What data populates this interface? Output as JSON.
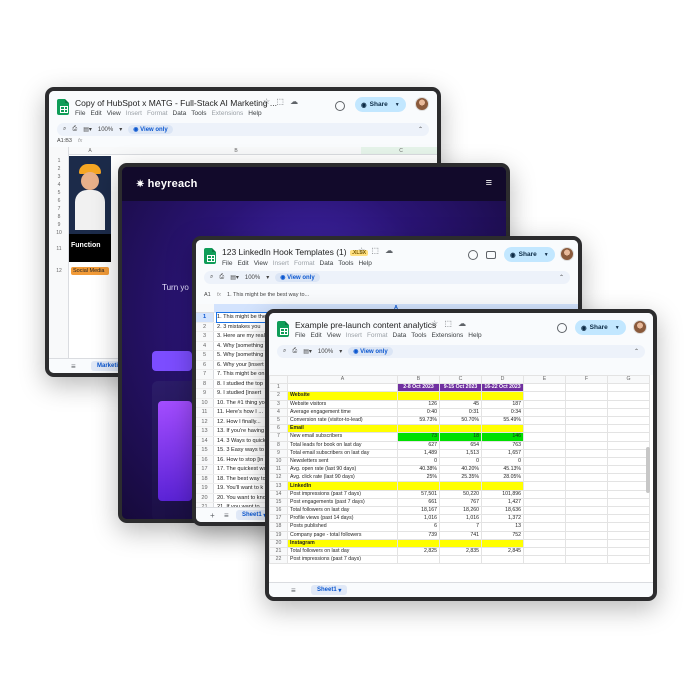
{
  "colors": {
    "accent_blue": "#0b57d0",
    "share_bg": "#c2e7ff",
    "sheets_green": "#0f9d58",
    "section_yellow": "#ffff00",
    "date_header_purple": "#7030a0",
    "highlight_green": "#00e000",
    "heyreach_bg": "#120a2b"
  },
  "win1": {
    "title": "Copy of HubSpot x MATG - Full-Stack AI Marketing ...",
    "menus": [
      "File",
      "Edit",
      "View",
      "Insert",
      "Format",
      "Data",
      "Tools",
      "Extensions",
      "Help"
    ],
    "share_label": "Share",
    "zoom": "100%",
    "view_only": "View only",
    "cell_ref": "A1:B3",
    "col_a": "A",
    "col_b": "B",
    "col_c": "C",
    "rows": [
      "1",
      "2",
      "3",
      "4",
      "5",
      "6",
      "7",
      "8",
      "9",
      "10",
      "11",
      "12"
    ],
    "function_label": "Function",
    "chip_label": "Social Media",
    "sheet_tab": "Marketin"
  },
  "win2": {
    "brand": "heyreach",
    "hero_text": "Turn yo"
  },
  "win3": {
    "title": "123 LinkedIn Hook Templates (1)",
    "badge": ".XLSX",
    "menus": [
      "File",
      "Edit",
      "View",
      "Insert",
      "Format",
      "Data",
      "Tools",
      "Help"
    ],
    "share_label": "Share",
    "zoom": "100%",
    "view_only": "View only",
    "cell_ref": "A1",
    "formula": "1. This might be the best way to...",
    "col_a": "A",
    "rows": [
      {
        "n": "1",
        "t": "1. This might be the"
      },
      {
        "n": "2",
        "t": "2. 3 mistakes you"
      },
      {
        "n": "3",
        "t": "3. Here are my real"
      },
      {
        "n": "4",
        "t": "4. Why [something"
      },
      {
        "n": "5",
        "t": "5. Why [something"
      },
      {
        "n": "6",
        "t": "6. Why your [insert"
      },
      {
        "n": "7",
        "t": "7. This might be on"
      },
      {
        "n": "8",
        "t": "8. I studied the top"
      },
      {
        "n": "9",
        "t": "9. I studied [insert"
      },
      {
        "n": "10",
        "t": "10. The #1 thing yo"
      },
      {
        "n": "11",
        "t": "11. Here's how I ..."
      },
      {
        "n": "12",
        "t": "12. How I finally..."
      },
      {
        "n": "13",
        "t": "13. If you're having"
      },
      {
        "n": "14",
        "t": "14. 3 Ways to quick"
      },
      {
        "n": "15",
        "t": "15. 3 Easy ways to"
      },
      {
        "n": "16",
        "t": "16. How to stop [in"
      },
      {
        "n": "17",
        "t": "17. The quickest wa"
      },
      {
        "n": "18",
        "t": "18. The best way to"
      },
      {
        "n": "19",
        "t": "19. You'll want to k"
      },
      {
        "n": "20",
        "t": "20. You want to kno"
      },
      {
        "n": "21",
        "t": "21. If you want to..."
      },
      {
        "n": "22",
        "t": "22. If you're ready"
      }
    ],
    "sheet_tab": "Sheet1"
  },
  "win4": {
    "title": "Example pre-launch content analytics",
    "menus": [
      "File",
      "Edit",
      "View",
      "Insert",
      "Format",
      "Data",
      "Tools",
      "Extensions",
      "Help"
    ],
    "share_label": "Share",
    "zoom": "100%",
    "view_only": "View only",
    "col_headers": [
      "A",
      "B",
      "C",
      "D",
      "E",
      "F",
      "G"
    ],
    "date_headers": [
      "2-8 Oct 2023",
      "9-15 Oct 2023",
      "16-22 Oct 2023"
    ],
    "rows": [
      {
        "n": "2",
        "label": "Website",
        "section": true
      },
      {
        "n": "3",
        "label": "Website visitors",
        "b": "126",
        "c": "45",
        "d": "187"
      },
      {
        "n": "4",
        "label": "Average engagement time",
        "b": "0:40",
        "c": "0:31",
        "d": "0:34"
      },
      {
        "n": "5",
        "label": "Conversion rate (visitor-to-lead)",
        "b": "59.73%",
        "c": "50.70%",
        "d": "55.49%"
      },
      {
        "n": "6",
        "label": "Email",
        "section": true
      },
      {
        "n": "7",
        "label": "New email subscribers",
        "b": "73",
        "c": "18",
        "d": "146",
        "green": true
      },
      {
        "n": "8",
        "label": "Total leads for book on last day",
        "b": "627",
        "c": "654",
        "d": "763"
      },
      {
        "n": "9",
        "label": "Total email subscribers on last day",
        "b": "1,489",
        "c": "1,513",
        "d": "1,657"
      },
      {
        "n": "10",
        "label": "Newsletters sent",
        "b": "0",
        "c": "0",
        "d": "0"
      },
      {
        "n": "11",
        "label": "Avg. open rate (last 90 days)",
        "b": "40.38%",
        "c": "40.20%",
        "d": "45.13%"
      },
      {
        "n": "12",
        "label": "Avg. click rate (last 90 days)",
        "b": "25%",
        "c": "25.35%",
        "d": "28.05%"
      },
      {
        "n": "13",
        "label": "LinkedIn",
        "section": true
      },
      {
        "n": "14",
        "label": "Post impressions (past 7 days)",
        "b": "57,501",
        "c": "50,220",
        "d": "101,896"
      },
      {
        "n": "15",
        "label": "Post engagements (past 7 days)",
        "b": "661",
        "c": "767",
        "d": "1,427"
      },
      {
        "n": "16",
        "label": "Total followers on last day",
        "b": "18,167",
        "c": "18,260",
        "d": "18,636"
      },
      {
        "n": "17",
        "label": "Profile views (past 14 days)",
        "b": "1,016",
        "c": "1,016",
        "d": "1,372"
      },
      {
        "n": "18",
        "label": "Posts published",
        "b": "6",
        "c": "7",
        "d": "13"
      },
      {
        "n": "19",
        "label": "Company page - total followers",
        "b": "739",
        "c": "741",
        "d": "752"
      },
      {
        "n": "20",
        "label": "Instagram",
        "section": true
      },
      {
        "n": "21",
        "label": "Total followers on last day",
        "b": "2,825",
        "c": "2,835",
        "d": "2,845"
      },
      {
        "n": "22",
        "label": "Post impressions (past 7 days)",
        "b": "",
        "c": "",
        "d": ""
      }
    ],
    "sheet_tab": "Sheet1"
  }
}
